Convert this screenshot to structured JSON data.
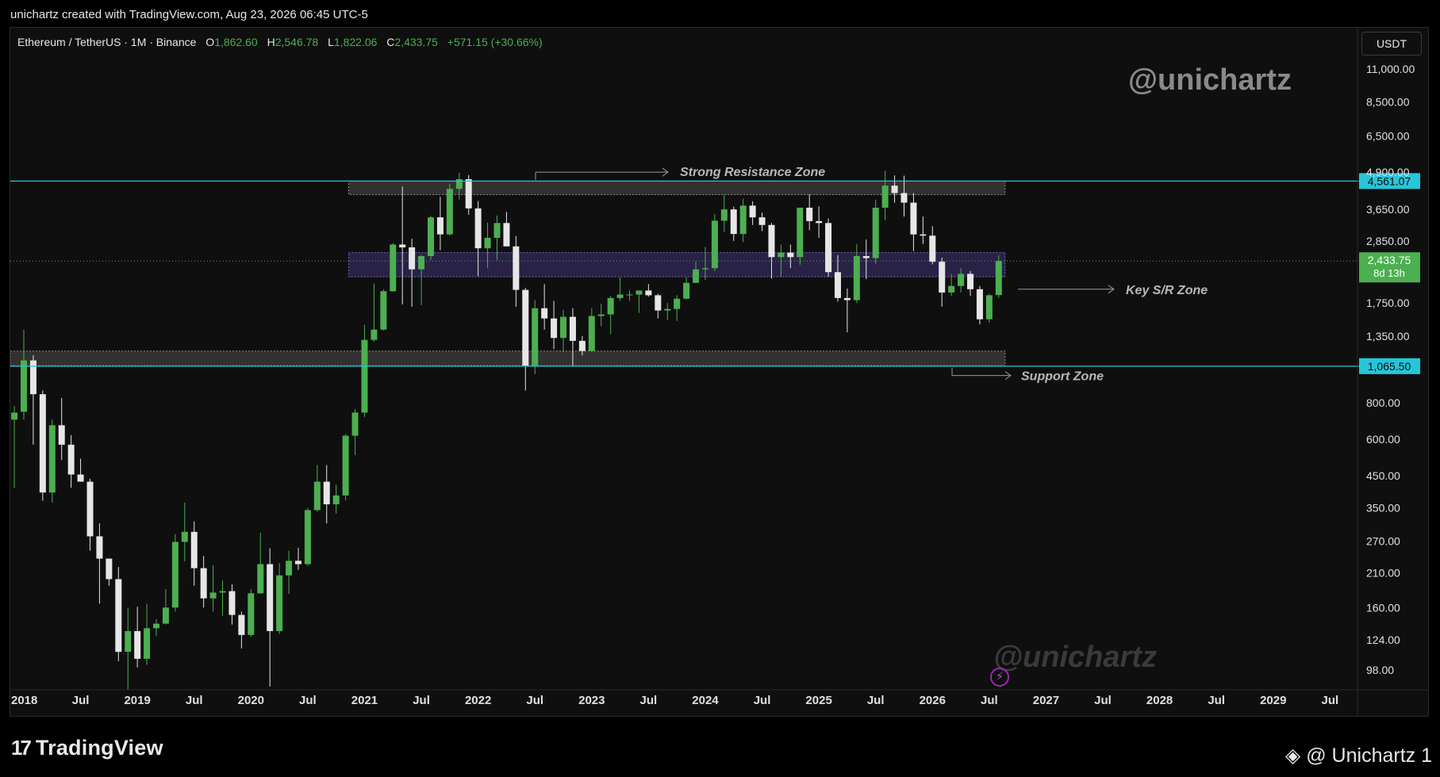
{
  "header": {
    "credit": "unichartz created with TradingView.com, Aug 23, 2026 06:45 UTC-5"
  },
  "legend": {
    "symbol": "Ethereum / TetherUS · 1M · Binance",
    "o_label": "O",
    "o_value": "1,862.60",
    "h_label": "H",
    "h_value": "2,546.78",
    "l_label": "L",
    "l_value": "1,822.06",
    "c_label": "C",
    "c_value": "2,433.75",
    "change": "+571.15 (+30.66%)"
  },
  "unit": "USDT",
  "watermarks": {
    "top": "@unichartz",
    "bottom": "@unichartz"
  },
  "footer": {
    "logo": "TradingView",
    "logo_mark": "17",
    "signature": "@ Unichartz 1"
  },
  "colors": {
    "background": "#0f0f0f",
    "up": "#4caf50",
    "down": "#e6e6e6",
    "level_line": "#26c6da",
    "price_label": "#4caf50",
    "key_zone": "#4a3a8a",
    "zone_gray": "#5a5a5a"
  },
  "chart_data": {
    "type": "candlestick",
    "scale": "log",
    "ylim": [
      85,
      13000
    ],
    "x_range": [
      "2017-12",
      "2029-12"
    ],
    "y_ticks": [
      {
        "value": 11000,
        "label": "11,000.00"
      },
      {
        "value": 8500,
        "label": "8,500.00"
      },
      {
        "value": 6500,
        "label": "6,500.00"
      },
      {
        "value": 4900,
        "label": "4,900.00"
      },
      {
        "value": 3650,
        "label": "3,650.00"
      },
      {
        "value": 2850,
        "label": "2,850.00"
      },
      {
        "value": 1750,
        "label": "1,750.00"
      },
      {
        "value": 1350,
        "label": "1,350.00"
      },
      {
        "value": 800,
        "label": "800.00"
      },
      {
        "value": 600,
        "label": "600.00"
      },
      {
        "value": 450,
        "label": "450.00"
      },
      {
        "value": 350,
        "label": "350.00"
      },
      {
        "value": 270,
        "label": "270.00"
      },
      {
        "value": 210,
        "label": "210.00"
      },
      {
        "value": 160,
        "label": "160.00"
      },
      {
        "value": 124,
        "label": "124.00"
      },
      {
        "value": 98,
        "label": "98.00"
      }
    ],
    "x_ticks": [
      {
        "date": "2018-01",
        "label": "2018",
        "major": true
      },
      {
        "date": "2018-07",
        "label": "Jul",
        "major": false
      },
      {
        "date": "2019-01",
        "label": "2019",
        "major": true
      },
      {
        "date": "2019-07",
        "label": "Jul",
        "major": false
      },
      {
        "date": "2020-01",
        "label": "2020",
        "major": true
      },
      {
        "date": "2020-07",
        "label": "Jul",
        "major": false
      },
      {
        "date": "2021-01",
        "label": "2021",
        "major": true
      },
      {
        "date": "2021-07",
        "label": "Jul",
        "major": false
      },
      {
        "date": "2022-01",
        "label": "2022",
        "major": true
      },
      {
        "date": "2022-07",
        "label": "Jul",
        "major": false
      },
      {
        "date": "2023-01",
        "label": "2023",
        "major": true
      },
      {
        "date": "2023-07",
        "label": "Jul",
        "major": false
      },
      {
        "date": "2024-01",
        "label": "2024",
        "major": true
      },
      {
        "date": "2024-07",
        "label": "Jul",
        "major": false
      },
      {
        "date": "2025-01",
        "label": "2025",
        "major": true
      },
      {
        "date": "2025-07",
        "label": "Jul",
        "major": false
      },
      {
        "date": "2026-01",
        "label": "2026",
        "major": true
      },
      {
        "date": "2026-07",
        "label": "Jul",
        "major": false
      },
      {
        "date": "2027-01",
        "label": "2027",
        "major": true
      },
      {
        "date": "2027-07",
        "label": "Jul",
        "major": false
      },
      {
        "date": "2028-01",
        "label": "2028",
        "major": true
      },
      {
        "date": "2028-07",
        "label": "Jul",
        "major": false
      },
      {
        "date": "2029-01",
        "label": "2029",
        "major": true
      },
      {
        "date": "2029-07",
        "label": "Jul",
        "major": false
      }
    ],
    "levels": [
      {
        "value": 4561.07,
        "label": "4,561.07"
      },
      {
        "value": 1065.5,
        "label": "1,065.50"
      }
    ],
    "current_price": {
      "value": 2433.75,
      "label": "2,433.75",
      "countdown": "8d 13h"
    },
    "zones": [
      {
        "name": "resistance",
        "from": "2021-00",
        "to": "2026-08",
        "low": 4100,
        "high": 4560
      },
      {
        "name": "key-sr",
        "from": "2021-00",
        "to": "2026-08",
        "low": 2150,
        "high": 2600
      },
      {
        "name": "support",
        "from": "2017-12",
        "to": "2026-08",
        "low": 1070,
        "high": 1200
      }
    ],
    "annotations": [
      {
        "text": "Strong Resistance Zone",
        "date": "2023-07",
        "value": 4800
      },
      {
        "text": "Key S/R Zone",
        "date": "2026-09",
        "value": 1950
      },
      {
        "text": "Support Zone",
        "date": "2026-02",
        "value": 990
      }
    ],
    "candles": [
      {
        "t": "2017-12",
        "o": 700,
        "h": 780,
        "l": 410,
        "c": 740
      },
      {
        "t": "2018-01",
        "o": 745,
        "h": 1420,
        "l": 700,
        "c": 1115
      },
      {
        "t": "2018-02",
        "o": 1115,
        "h": 1160,
        "l": 575,
        "c": 855
      },
      {
        "t": "2018-03",
        "o": 855,
        "h": 880,
        "l": 370,
        "c": 395
      },
      {
        "t": "2018-04",
        "o": 395,
        "h": 700,
        "l": 365,
        "c": 670
      },
      {
        "t": "2018-05",
        "o": 670,
        "h": 830,
        "l": 510,
        "c": 575
      },
      {
        "t": "2018-06",
        "o": 575,
        "h": 620,
        "l": 410,
        "c": 455
      },
      {
        "t": "2018-07",
        "o": 455,
        "h": 515,
        "l": 430,
        "c": 430
      },
      {
        "t": "2018-08",
        "o": 430,
        "h": 440,
        "l": 250,
        "c": 280
      },
      {
        "t": "2018-09",
        "o": 280,
        "h": 310,
        "l": 165,
        "c": 235
      },
      {
        "t": "2018-10",
        "o": 235,
        "h": 235,
        "l": 190,
        "c": 200
      },
      {
        "t": "2018-11",
        "o": 200,
        "h": 220,
        "l": 105,
        "c": 113
      },
      {
        "t": "2018-12",
        "o": 113,
        "h": 160,
        "l": 82,
        "c": 133
      },
      {
        "t": "2019-01",
        "o": 133,
        "h": 161,
        "l": 100,
        "c": 107
      },
      {
        "t": "2019-02",
        "o": 107,
        "h": 165,
        "l": 102,
        "c": 136
      },
      {
        "t": "2019-03",
        "o": 136,
        "h": 146,
        "l": 128,
        "c": 141
      },
      {
        "t": "2019-04",
        "o": 141,
        "h": 185,
        "l": 140,
        "c": 160
      },
      {
        "t": "2019-05",
        "o": 160,
        "h": 285,
        "l": 155,
        "c": 268
      },
      {
        "t": "2019-06",
        "o": 268,
        "h": 365,
        "l": 230,
        "c": 290
      },
      {
        "t": "2019-07",
        "o": 290,
        "h": 315,
        "l": 190,
        "c": 218
      },
      {
        "t": "2019-08",
        "o": 218,
        "h": 240,
        "l": 160,
        "c": 172
      },
      {
        "t": "2019-09",
        "o": 172,
        "h": 223,
        "l": 155,
        "c": 180
      },
      {
        "t": "2019-10",
        "o": 180,
        "h": 198,
        "l": 150,
        "c": 182
      },
      {
        "t": "2019-11",
        "o": 182,
        "h": 192,
        "l": 140,
        "c": 151
      },
      {
        "t": "2019-12",
        "o": 151,
        "h": 155,
        "l": 116,
        "c": 129
      },
      {
        "t": "2020-01",
        "o": 129,
        "h": 185,
        "l": 127,
        "c": 179
      },
      {
        "t": "2020-02",
        "o": 179,
        "h": 288,
        "l": 178,
        "c": 225
      },
      {
        "t": "2020-03",
        "o": 225,
        "h": 255,
        "l": 86,
        "c": 133
      },
      {
        "t": "2020-04",
        "o": 133,
        "h": 227,
        "l": 130,
        "c": 206
      },
      {
        "t": "2020-05",
        "o": 206,
        "h": 250,
        "l": 178,
        "c": 231
      },
      {
        "t": "2020-06",
        "o": 231,
        "h": 256,
        "l": 215,
        "c": 225
      },
      {
        "t": "2020-07",
        "o": 225,
        "h": 350,
        "l": 222,
        "c": 344
      },
      {
        "t": "2020-08",
        "o": 344,
        "h": 490,
        "l": 340,
        "c": 430
      },
      {
        "t": "2020-09",
        "o": 430,
        "h": 490,
        "l": 310,
        "c": 360
      },
      {
        "t": "2020-10",
        "o": 360,
        "h": 420,
        "l": 335,
        "c": 386
      },
      {
        "t": "2020-11",
        "o": 386,
        "h": 625,
        "l": 372,
        "c": 617
      },
      {
        "t": "2020-12",
        "o": 617,
        "h": 760,
        "l": 530,
        "c": 740
      },
      {
        "t": "2021-01",
        "o": 740,
        "h": 1475,
        "l": 715,
        "c": 1310
      },
      {
        "t": "2021-02",
        "o": 1310,
        "h": 2040,
        "l": 1290,
        "c": 1420
      },
      {
        "t": "2021-03",
        "o": 1420,
        "h": 1950,
        "l": 1410,
        "c": 1920
      },
      {
        "t": "2021-04",
        "o": 1920,
        "h": 2800,
        "l": 1910,
        "c": 2770
      },
      {
        "t": "2021-05",
        "o": 2770,
        "h": 4370,
        "l": 1730,
        "c": 2710
      },
      {
        "t": "2021-06",
        "o": 2710,
        "h": 2900,
        "l": 1700,
        "c": 2280
      },
      {
        "t": "2021-07",
        "o": 2280,
        "h": 2550,
        "l": 1720,
        "c": 2530
      },
      {
        "t": "2021-08",
        "o": 2530,
        "h": 3470,
        "l": 2450,
        "c": 3430
      },
      {
        "t": "2021-09",
        "o": 3430,
        "h": 4030,
        "l": 2650,
        "c": 3000
      },
      {
        "t": "2021-10",
        "o": 3000,
        "h": 4460,
        "l": 2970,
        "c": 4290
      },
      {
        "t": "2021-11",
        "o": 4290,
        "h": 4870,
        "l": 3950,
        "c": 4630
      },
      {
        "t": "2021-12",
        "o": 4630,
        "h": 4780,
        "l": 3500,
        "c": 3680
      },
      {
        "t": "2022-01",
        "o": 3680,
        "h": 3900,
        "l": 2160,
        "c": 2690
      },
      {
        "t": "2022-02",
        "o": 2690,
        "h": 3290,
        "l": 2300,
        "c": 2920
      },
      {
        "t": "2022-03",
        "o": 2920,
        "h": 3480,
        "l": 2450,
        "c": 3280
      },
      {
        "t": "2022-04",
        "o": 3280,
        "h": 3580,
        "l": 2760,
        "c": 2730
      },
      {
        "t": "2022-05",
        "o": 2730,
        "h": 2960,
        "l": 1700,
        "c": 1940
      },
      {
        "t": "2022-06",
        "o": 1940,
        "h": 1970,
        "l": 880,
        "c": 1070
      },
      {
        "t": "2022-07",
        "o": 1070,
        "h": 1790,
        "l": 1000,
        "c": 1680
      },
      {
        "t": "2022-08",
        "o": 1680,
        "h": 2030,
        "l": 1420,
        "c": 1550
      },
      {
        "t": "2022-09",
        "o": 1550,
        "h": 1780,
        "l": 1220,
        "c": 1330
      },
      {
        "t": "2022-10",
        "o": 1330,
        "h": 1660,
        "l": 1190,
        "c": 1570
      },
      {
        "t": "2022-11",
        "o": 1570,
        "h": 1680,
        "l": 1070,
        "c": 1300
      },
      {
        "t": "2022-12",
        "o": 1300,
        "h": 1350,
        "l": 1160,
        "c": 1200
      },
      {
        "t": "2023-01",
        "o": 1200,
        "h": 1680,
        "l": 1190,
        "c": 1580
      },
      {
        "t": "2023-02",
        "o": 1580,
        "h": 1740,
        "l": 1460,
        "c": 1600
      },
      {
        "t": "2023-03",
        "o": 1600,
        "h": 1850,
        "l": 1370,
        "c": 1820
      },
      {
        "t": "2023-04",
        "o": 1820,
        "h": 2140,
        "l": 1780,
        "c": 1870
      },
      {
        "t": "2023-05",
        "o": 1870,
        "h": 1930,
        "l": 1780,
        "c": 1870
      },
      {
        "t": "2023-06",
        "o": 1870,
        "h": 1930,
        "l": 1620,
        "c": 1930
      },
      {
        "t": "2023-07",
        "o": 1930,
        "h": 2030,
        "l": 1840,
        "c": 1860
      },
      {
        "t": "2023-08",
        "o": 1860,
        "h": 1880,
        "l": 1550,
        "c": 1650
      },
      {
        "t": "2023-09",
        "o": 1650,
        "h": 1750,
        "l": 1530,
        "c": 1670
      },
      {
        "t": "2023-10",
        "o": 1670,
        "h": 1860,
        "l": 1520,
        "c": 1810
      },
      {
        "t": "2023-11",
        "o": 1810,
        "h": 2140,
        "l": 1800,
        "c": 2050
      },
      {
        "t": "2023-12",
        "o": 2050,
        "h": 2420,
        "l": 2050,
        "c": 2280
      },
      {
        "t": "2024-01",
        "o": 2280,
        "h": 2720,
        "l": 2100,
        "c": 2300
      },
      {
        "t": "2024-02",
        "o": 2300,
        "h": 3520,
        "l": 2250,
        "c": 3340
      },
      {
        "t": "2024-03",
        "o": 3340,
        "h": 4090,
        "l": 3060,
        "c": 3650
      },
      {
        "t": "2024-04",
        "o": 3650,
        "h": 3730,
        "l": 2850,
        "c": 3010
      },
      {
        "t": "2024-05",
        "o": 3010,
        "h": 3970,
        "l": 2820,
        "c": 3760
      },
      {
        "t": "2024-06",
        "o": 3760,
        "h": 3890,
        "l": 3230,
        "c": 3430
      },
      {
        "t": "2024-07",
        "o": 3430,
        "h": 3560,
        "l": 3080,
        "c": 3230
      },
      {
        "t": "2024-08",
        "o": 3230,
        "h": 3280,
        "l": 2120,
        "c": 2510
      },
      {
        "t": "2024-09",
        "o": 2510,
        "h": 2770,
        "l": 2150,
        "c": 2600
      },
      {
        "t": "2024-10",
        "o": 2600,
        "h": 2770,
        "l": 2300,
        "c": 2510
      },
      {
        "t": "2024-11",
        "o": 2510,
        "h": 3680,
        "l": 2360,
        "c": 3700
      },
      {
        "t": "2024-12",
        "o": 3700,
        "h": 4110,
        "l": 3100,
        "c": 3330
      },
      {
        "t": "2025-01",
        "o": 3330,
        "h": 3740,
        "l": 2920,
        "c": 3280
      },
      {
        "t": "2025-02",
        "o": 3280,
        "h": 3400,
        "l": 2150,
        "c": 2230
      },
      {
        "t": "2025-03",
        "o": 2230,
        "h": 2550,
        "l": 1770,
        "c": 1820
      },
      {
        "t": "2025-04",
        "o": 1820,
        "h": 1960,
        "l": 1390,
        "c": 1790
      },
      {
        "t": "2025-05",
        "o": 1790,
        "h": 2780,
        "l": 1750,
        "c": 2530
      },
      {
        "t": "2025-06",
        "o": 2530,
        "h": 2880,
        "l": 2110,
        "c": 2490
      },
      {
        "t": "2025-07",
        "o": 2490,
        "h": 3940,
        "l": 2380,
        "c": 3700
      },
      {
        "t": "2025-08",
        "o": 3700,
        "h": 4950,
        "l": 3350,
        "c": 4400
      },
      {
        "t": "2025-09",
        "o": 4400,
        "h": 4770,
        "l": 3850,
        "c": 4150
      },
      {
        "t": "2025-10",
        "o": 4150,
        "h": 4760,
        "l": 3450,
        "c": 3850
      },
      {
        "t": "2025-11",
        "o": 3850,
        "h": 4150,
        "l": 2630,
        "c": 3000
      },
      {
        "t": "2025-12",
        "o": 3000,
        "h": 3450,
        "l": 2780,
        "c": 2970
      },
      {
        "t": "2026-01",
        "o": 2970,
        "h": 3200,
        "l": 2370,
        "c": 2420
      },
      {
        "t": "2026-02",
        "o": 2420,
        "h": 2500,
        "l": 1700,
        "c": 1900
      },
      {
        "t": "2026-03",
        "o": 1900,
        "h": 2200,
        "l": 1850,
        "c": 2000
      },
      {
        "t": "2026-04",
        "o": 2000,
        "h": 2300,
        "l": 1900,
        "c": 2200
      },
      {
        "t": "2026-05",
        "o": 2200,
        "h": 2250,
        "l": 1850,
        "c": 1950
      },
      {
        "t": "2026-06",
        "o": 1950,
        "h": 2000,
        "l": 1480,
        "c": 1540
      },
      {
        "t": "2026-07",
        "o": 1540,
        "h": 1880,
        "l": 1500,
        "c": 1860
      },
      {
        "t": "2026-08",
        "o": 1862.6,
        "h": 2546.78,
        "l": 1822.06,
        "c": 2433.75
      }
    ]
  }
}
